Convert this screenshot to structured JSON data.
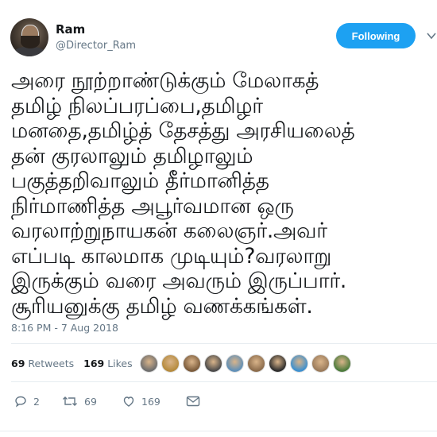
{
  "tweet": {
    "author_name": "Ram",
    "author_handle": "@Director_Ram",
    "follow_label": "Following",
    "text_lines": [
      "அரை நூற்றாண்டுக்கும் மேலாகத்",
      "தமிழ் நிலப்பரப்பை,தமிழர்",
      "மனதை,தமிழ்த் தேசத்து அரசியலைத்",
      "தன் குரலாலும் தமிழாலும்",
      "பகுத்தறிவாலும் தீர்மானித்த",
      "நிர்மாணித்த அபூர்வமான ஒரு",
      "வரலாற்றுநாயகன் கலைஞர்.அவர்",
      "எப்படி காலமாக முடியும்?வரலாறு",
      "இருக்கும் வரை அவரும் இருப்பார்.",
      "சூரியனுக்கு தமிழ் வணக்கங்கள்."
    ],
    "timestamp": "8:16 PM - 7 Aug 2018",
    "retweets_count": "69",
    "retweets_label": "Retweets",
    "likes_count": "169",
    "likes_label": "Likes",
    "liker_avatar_colors": [
      "#6d6d6d",
      "#b58a3c",
      "#7a5a3a",
      "#4a4a4a",
      "#5e8fb8",
      "#8a6a4a",
      "#2a2a2a",
      "#3a8fd0",
      "#9a7a5a",
      "#4a7a3a"
    ],
    "actions": {
      "replies": "2",
      "retweets": "69",
      "likes": "169"
    }
  },
  "colors": {
    "accent": "#1da1f2",
    "muted": "#657786",
    "text": "#14171a"
  }
}
